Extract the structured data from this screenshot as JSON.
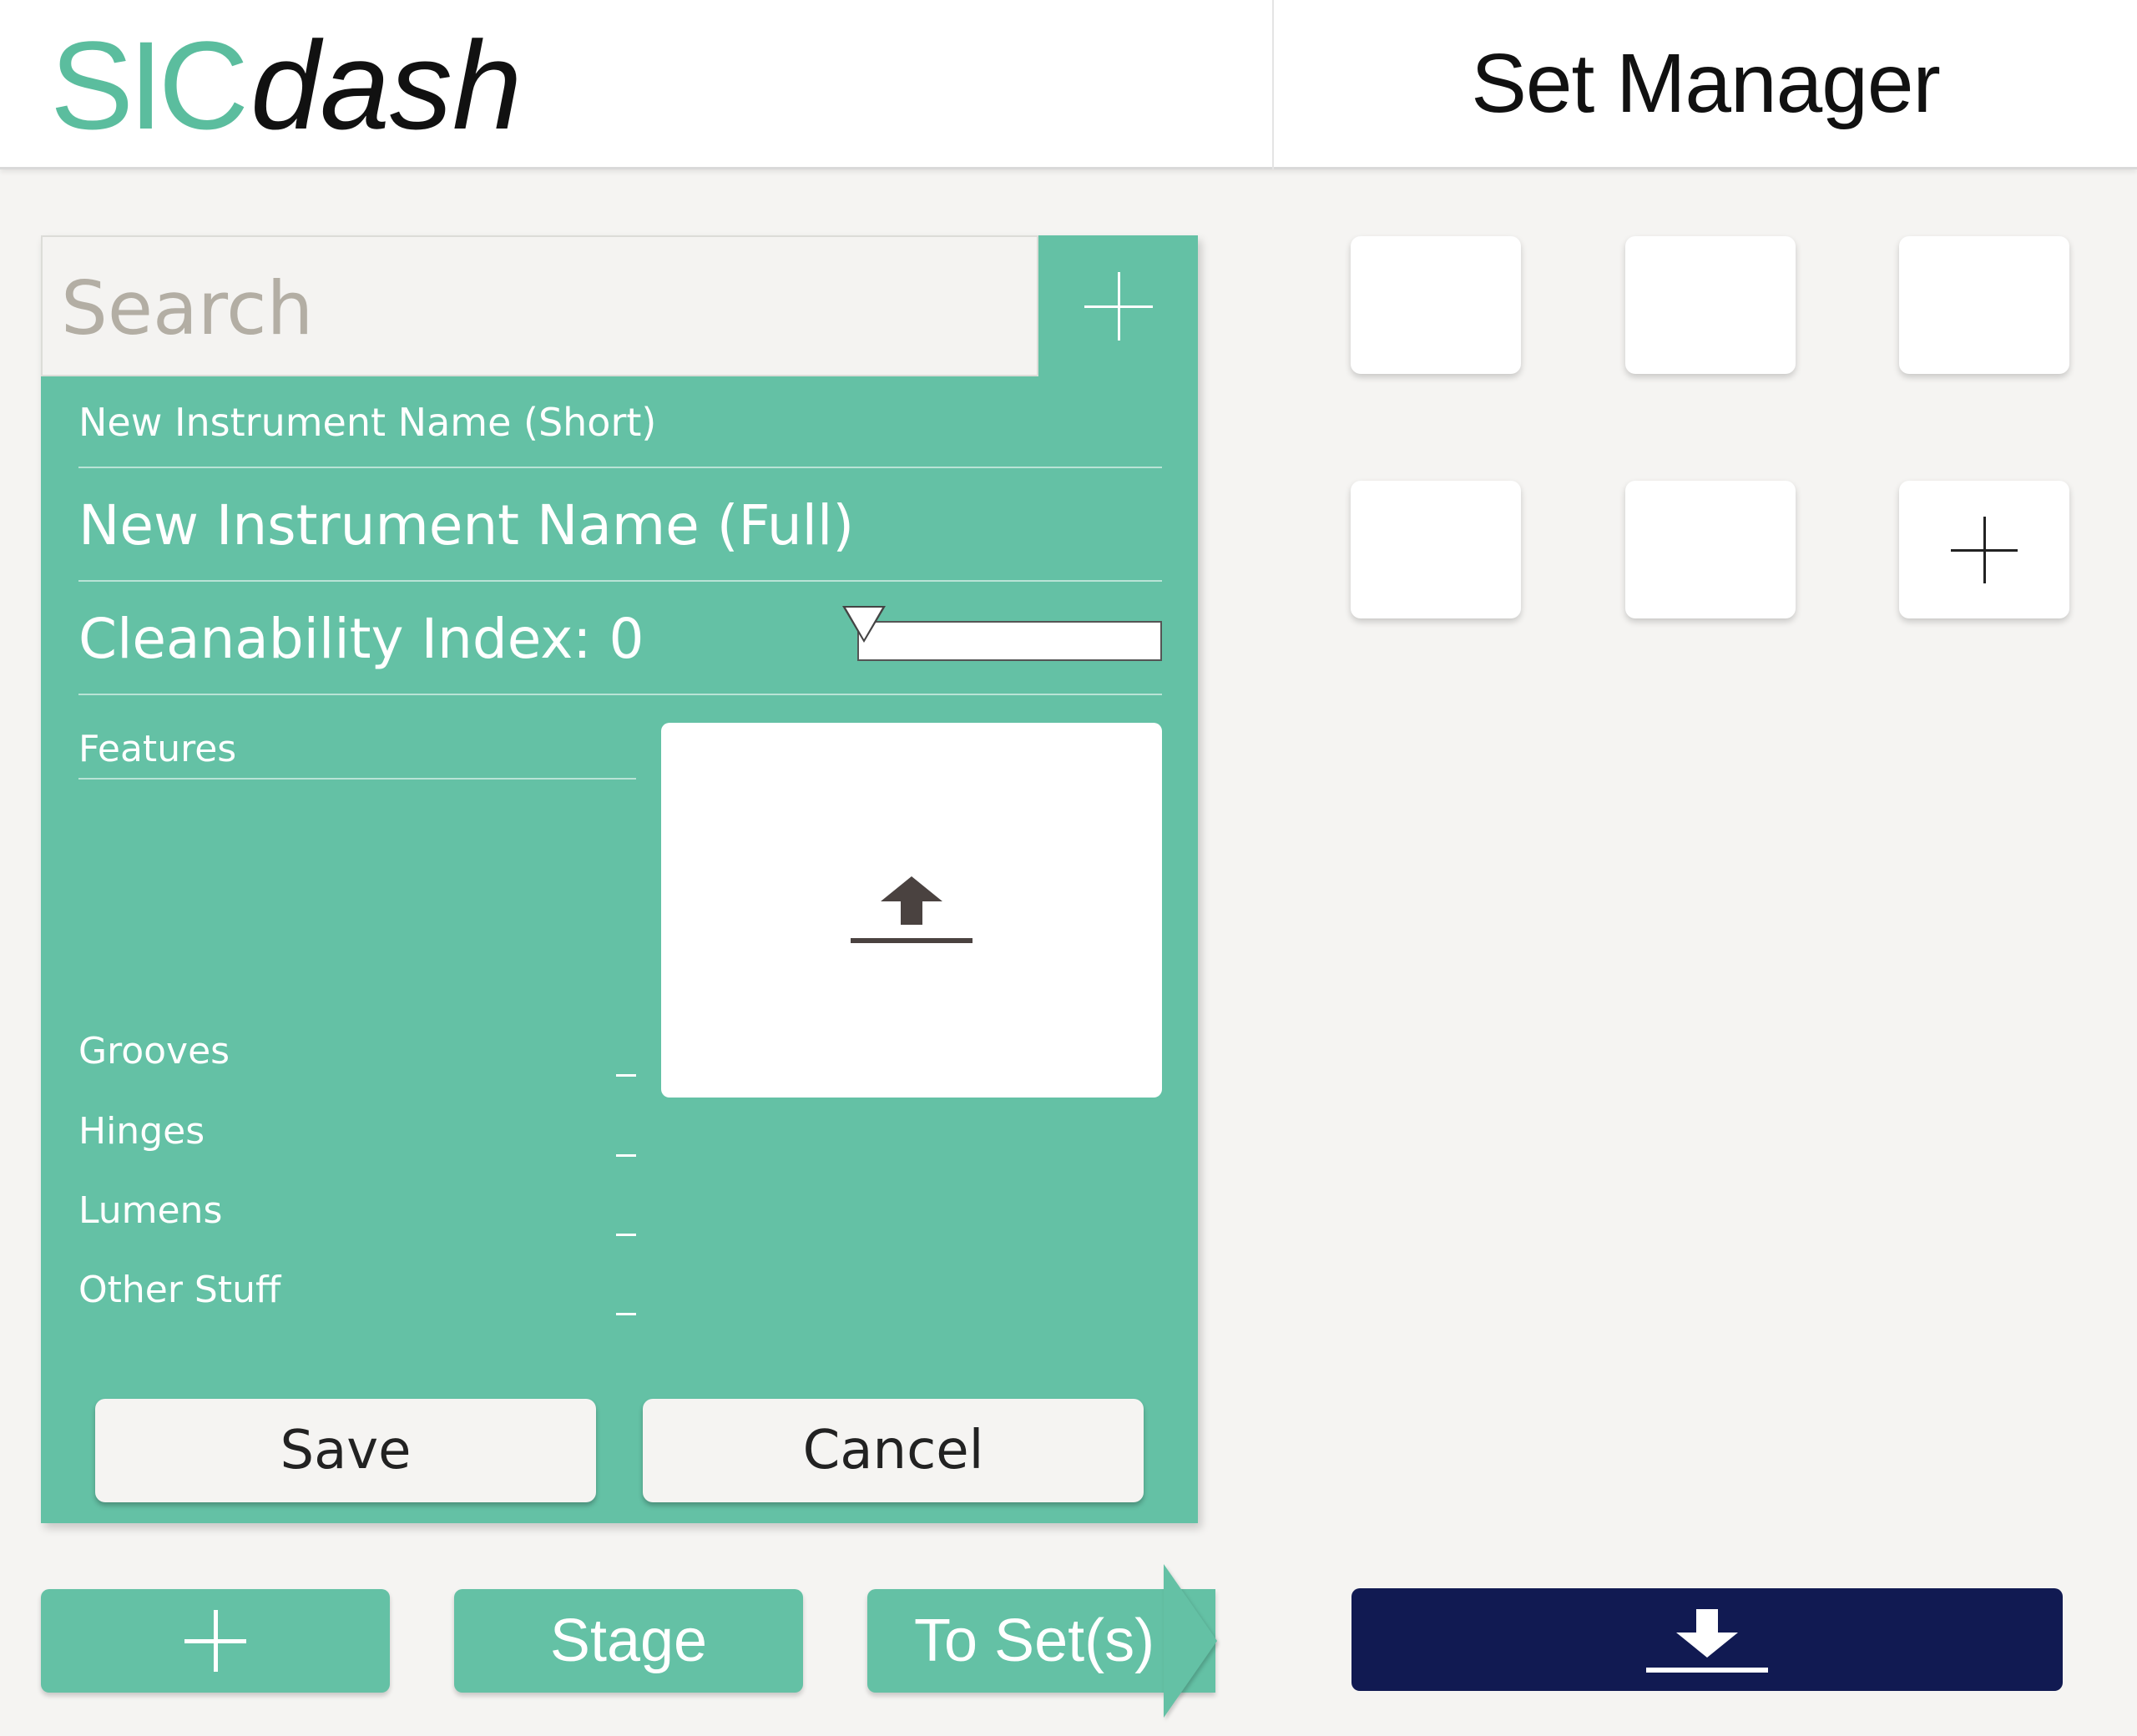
{
  "header": {
    "logo_part1": "SIC",
    "logo_part2": "dash",
    "title": "Set Manager"
  },
  "editor": {
    "search": {
      "placeholder": "Search",
      "value": ""
    },
    "short_name": "New Instrument Name (Short)",
    "full_name": "New Instrument Name (Full)",
    "cleanability": {
      "label": "Cleanability Index: 0",
      "value": 0
    },
    "features": {
      "heading": "Features",
      "items": [
        {
          "label": "Grooves",
          "value": "_"
        },
        {
          "label": "Hinges",
          "value": "_"
        },
        {
          "label": "Lumens",
          "value": "_"
        },
        {
          "label": "Other Stuff",
          "value": "_"
        }
      ]
    },
    "upload_icon": "upload-icon",
    "save_label": "Save",
    "cancel_label": "Cancel"
  },
  "bottom_bar": {
    "add_icon": "plus-icon",
    "stage_label": "Stage",
    "to_sets_label": "To Set(s)",
    "download_icon": "download-icon"
  },
  "sets": {
    "tile_count": 5,
    "add_icon": "plus-icon"
  },
  "colors": {
    "accent": "#64c1a5",
    "logo_accent": "#5bbd9e",
    "download_bg": "#111a52",
    "background": "#f5f4f2"
  }
}
